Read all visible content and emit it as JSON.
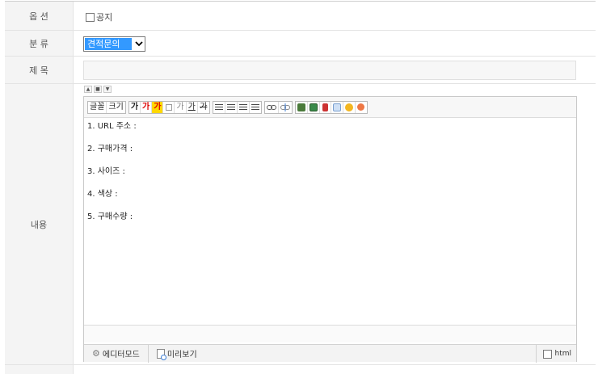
{
  "form": {
    "option": {
      "label": "옵 션",
      "notice_label": "공지",
      "notice_checked": false
    },
    "category": {
      "label": "분 류",
      "selected": "견적문의"
    },
    "subject": {
      "label": "제 목",
      "value": ""
    },
    "content": {
      "label": "내용"
    }
  },
  "editor": {
    "toolbar": {
      "font_label": "글꼴",
      "size_label": "크기",
      "btn_ga": "가",
      "btn_ga_red": "가",
      "btn_ga_hl": "가",
      "btn_ga_gray": "가",
      "btn_ga_sup": "가",
      "btn_ga_strike": "가"
    },
    "body_lines": [
      "1. URL 주소 :",
      "2. 구매가격 :",
      "3. 사이즈 :",
      "4. 색상 :",
      "5. 구매수량 :"
    ],
    "footer": {
      "editor_mode": "에디터모드",
      "preview": "미리보기",
      "html_label": "html",
      "html_checked": false
    }
  },
  "colors": {
    "select_highlight": "#3399ff",
    "label_bg": "#f4f4f4",
    "highlight_yellow": "#ffd800"
  }
}
